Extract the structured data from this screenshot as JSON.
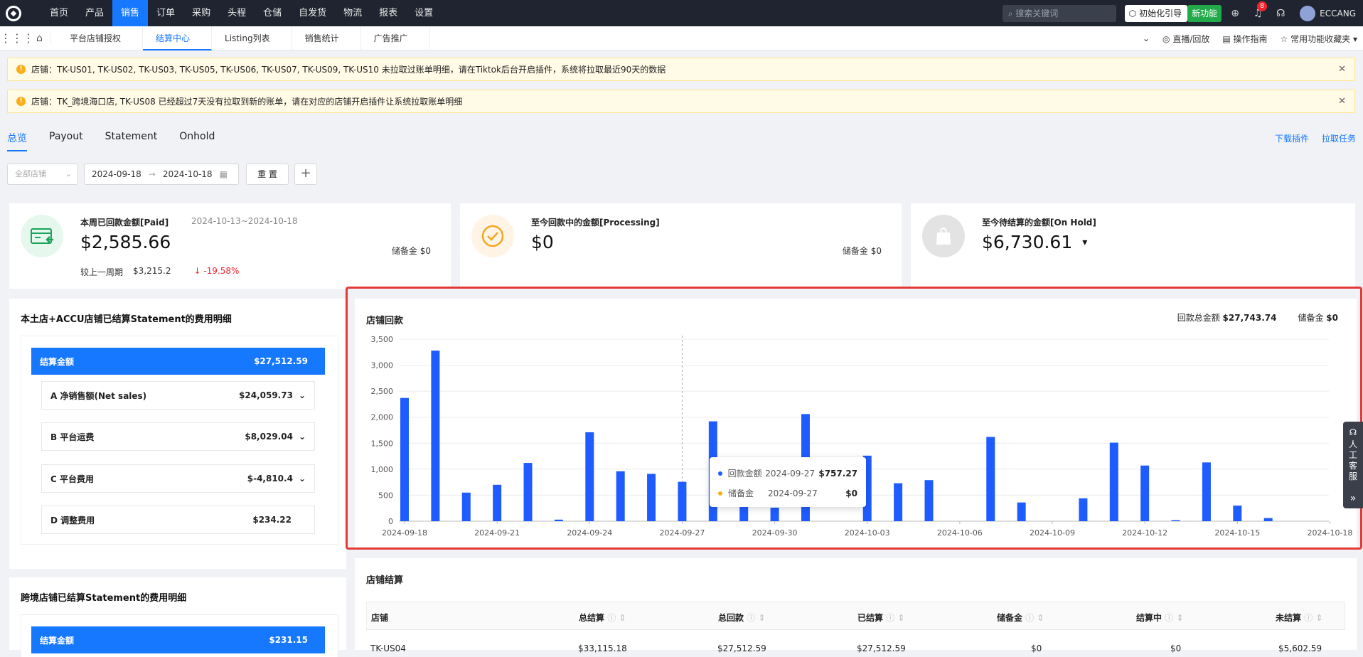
{
  "topnav": {
    "items": [
      "首页",
      "产品",
      "销售",
      "订单",
      "采购",
      "头程",
      "仓储",
      "自发货",
      "物流",
      "报表",
      "设置"
    ],
    "active_index": 2,
    "search_placeholder": "搜索关键词",
    "init_guide": "初始化引导",
    "new_feature": "新功能",
    "notif_count": "8",
    "user": "ECCANG"
  },
  "subnav": {
    "tabs": [
      "平台店铺授权",
      "结算中心",
      "Listing列表",
      "销售统计",
      "广告推广"
    ],
    "active_index": 1,
    "right": [
      "直播/回放",
      "操作指南",
      "常用功能收藏夹"
    ]
  },
  "alerts": [
    "店铺：TK-US01, TK-US02, TK-US03, TK-US05, TK-US06, TK-US07, TK-US09, TK-US10 未拉取过账单明细，请在Tiktok后台开启插件，系统将拉取最近90天的数据",
    "店铺：TK_跨境海口店, TK-US08 已经超过7天没有拉取到新的账单，请在对应的店铺开启插件让系统拉取账单明细"
  ],
  "tabs": [
    "总览",
    "Payout",
    "Statement",
    "Onhold"
  ],
  "tab_links": [
    "下载插件",
    "拉取任务"
  ],
  "filters": {
    "store_placeholder": "全部店铺",
    "date_start": "2024-09-18",
    "date_sep": "→",
    "date_end": "2024-10-18",
    "reset": "重 置",
    "add": "+"
  },
  "kpis": [
    {
      "title": "本周已回款金额[Paid]",
      "range": "2024-10-13~2024-10-18",
      "value": "$2,585.66",
      "reserve": "储备金 $0",
      "cmp_label": "较上一周期",
      "cmp_value": "$3,215.2",
      "cmp_change": "↓ -19.58%"
    },
    {
      "title": "至今回款中的金额[Processing]",
      "value": "$0",
      "reserve": "储备金 $0"
    },
    {
      "title": "至今待结算的金额[On Hold]",
      "value": "$6,730.61",
      "caret": "▾"
    }
  ],
  "local_breakdown": {
    "title": "本土店+ACCU店铺已结算Statement的费用明细",
    "total_label": "结算金额",
    "total_value": "$27,512.59",
    "rows": [
      {
        "label": "A 净销售额(Net sales)",
        "value": "$24,059.73",
        "chevron": "⌄"
      },
      {
        "label": "B 平台运费",
        "value": "$8,029.04",
        "chevron": "⌄"
      },
      {
        "label": "C 平台费用",
        "value": "$-4,810.4",
        "chevron": "⌄"
      },
      {
        "label": "D 调整费用",
        "value": "$234.22",
        "chevron": ""
      }
    ]
  },
  "cross_breakdown": {
    "title": "跨境店铺已结算Statement的费用明细",
    "total_label": "结算金额",
    "total_value": "$231.15"
  },
  "chart_section": {
    "title": "店铺回款",
    "total_label": "回款总金额",
    "total_value": "$27,743.74",
    "reserve_label": "储备金",
    "reserve_value": "$0"
  },
  "tooltip": {
    "rows": [
      {
        "name": "回款金额",
        "date": "2024-09-27",
        "value": "$757.27",
        "color": "#1f5cff"
      },
      {
        "name": "储备金",
        "date": "2024-09-27",
        "value": "$0",
        "color": "#faad14"
      }
    ]
  },
  "chart_data": {
    "type": "bar",
    "x": [
      "2024-09-18",
      "2024-09-19",
      "2024-09-20",
      "2024-09-21",
      "2024-09-22",
      "2024-09-23",
      "2024-09-24",
      "2024-09-25",
      "2024-09-26",
      "2024-09-27",
      "2024-09-28",
      "2024-09-29",
      "2024-09-30",
      "2024-10-01",
      "2024-10-02",
      "2024-10-03",
      "2024-10-04",
      "2024-10-05",
      "2024-10-06",
      "2024-10-07",
      "2024-10-08",
      "2024-10-09",
      "2024-10-10",
      "2024-10-11",
      "2024-10-12",
      "2024-10-13",
      "2024-10-14",
      "2024-10-15",
      "2024-10-16",
      "2024-10-17",
      "2024-10-18"
    ],
    "x_tick_labels": [
      "2024-09-18",
      "2024-09-21",
      "2024-09-24",
      "2024-09-27",
      "2024-09-30",
      "2024-10-03",
      "2024-10-06",
      "2024-10-09",
      "2024-10-12",
      "2024-10-15",
      "2024-10-18"
    ],
    "series": [
      {
        "name": "回款金额",
        "color": "#1f5cff",
        "values": [
          2370,
          3280,
          550,
          700,
          1120,
          30,
          1710,
          960,
          910,
          757.27,
          1920,
          550,
          260,
          2060,
          0,
          1260,
          730,
          790,
          0,
          1620,
          360,
          0,
          440,
          1510,
          1070,
          20,
          1130,
          300,
          60,
          0,
          0
        ]
      },
      {
        "name": "储备金",
        "color": "#faad14",
        "values": [
          0,
          0,
          0,
          0,
          0,
          0,
          0,
          0,
          0,
          0,
          0,
          0,
          0,
          0,
          0,
          0,
          0,
          0,
          0,
          0,
          0,
          0,
          0,
          0,
          0,
          0,
          0,
          0,
          0,
          0,
          0
        ]
      }
    ],
    "ylim": [
      0,
      3500
    ],
    "yticks": [
      0,
      500,
      1000,
      1500,
      2000,
      2500,
      3000,
      3500
    ],
    "grid": true,
    "hover_index": 9
  },
  "store_table": {
    "title": "店铺结算",
    "columns": [
      "店铺",
      "总结算",
      "总回款",
      "已结算",
      "储备金",
      "结算中",
      "未结算"
    ],
    "rows": [
      [
        "TK-US04",
        "$33,115.18",
        "$27,512.59",
        "$27,512.59",
        "$0",
        "$0",
        "$5,602.59"
      ]
    ]
  },
  "side_service": {
    "label": "人工客服",
    "arrow": "»"
  }
}
